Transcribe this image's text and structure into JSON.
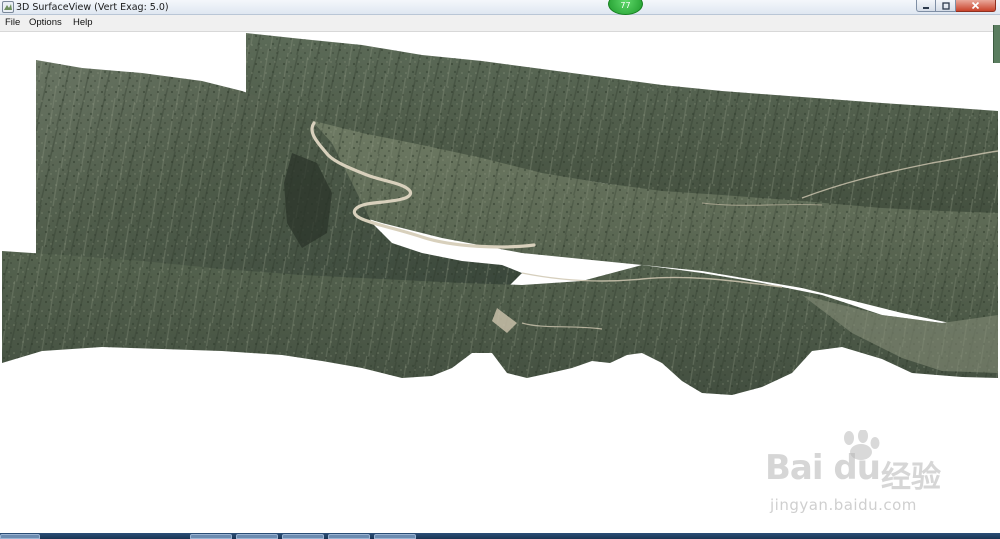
{
  "window": {
    "title": "3D SurfaceView (Vert Exag: 5.0)",
    "badge_count": "77"
  },
  "menubar": {
    "items": [
      {
        "label": "File"
      },
      {
        "label": "Options"
      },
      {
        "label": "Help"
      }
    ]
  },
  "watermark": {
    "brand": "Bai du",
    "chinese": "经验",
    "url": "jingyan.baidu.com"
  },
  "colors": {
    "terrain_dark": "#3e4a3c",
    "terrain_mid": "#5f6e58",
    "terrain_light": "#8a957c",
    "road": "#d9d2c0",
    "titlebar": "#dfe7f1",
    "close_button": "#c8432b",
    "badge": "#1e9a2b"
  },
  "icons": [
    "app-icon",
    "minimize-icon",
    "maximize-icon",
    "close-icon"
  ]
}
